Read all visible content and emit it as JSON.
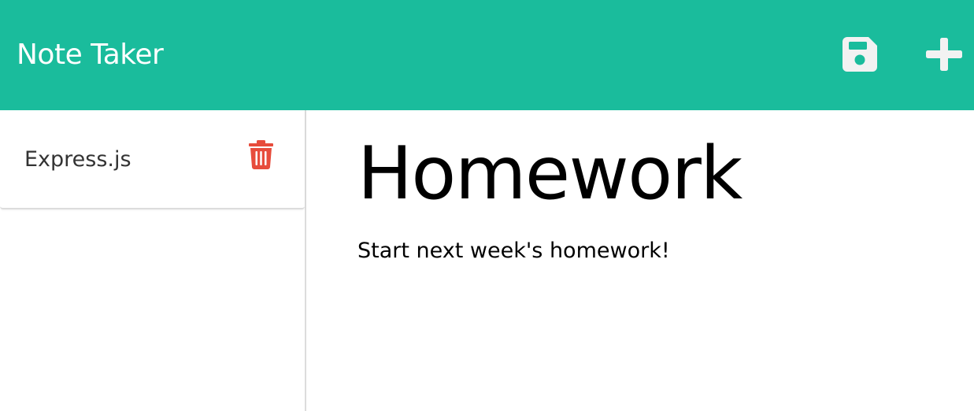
{
  "navbar": {
    "brand": "Note Taker",
    "save_icon": "save-icon",
    "new_note_icon": "plus-icon",
    "background": "#1abc9c"
  },
  "sidebar": {
    "notes": [
      {
        "title": "Express.js",
        "delete_icon": "trash-icon",
        "delete_color": "#e74c3c"
      }
    ]
  },
  "note": {
    "title": "Homework",
    "text": "Start next week's homework!"
  }
}
